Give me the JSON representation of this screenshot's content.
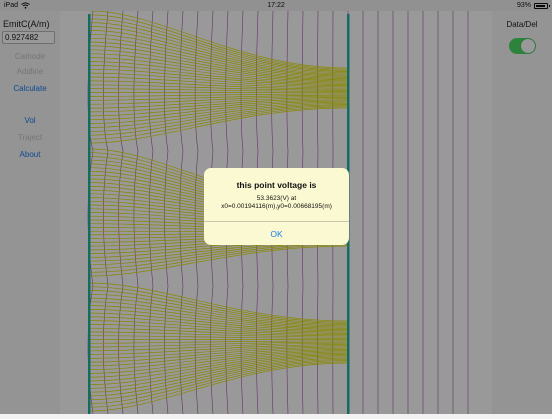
{
  "status_bar": {
    "device": "iPad",
    "time": "17:22",
    "battery": "93%",
    "battery_level": 0.93
  },
  "left_panel": {
    "emit_label": "EmitC(A/m)",
    "emit_value": "0.927482",
    "buttons": [
      {
        "label": "Cathode",
        "enabled": false
      },
      {
        "label": "Addline",
        "enabled": false
      },
      {
        "label": "Calculate",
        "enabled": true
      },
      {
        "label": "Vol",
        "enabled": true
      },
      {
        "label": "Traject",
        "enabled": false
      },
      {
        "label": "About",
        "enabled": true
      }
    ]
  },
  "right_panel": {
    "toggle_label": "Data/Del",
    "toggle_on": true
  },
  "alert": {
    "title": "this point voltage is",
    "line1": "53.3623(V) at",
    "line2": "x0=0.00194116(m),y0=0.00668195(m)",
    "ok_label": "OK"
  },
  "colors": {
    "beam": "#e3e300",
    "electrode": "#1fb5a8",
    "equipotential": "#a058a8",
    "accent": "#1a7cf0",
    "toggle_on": "#4cd964"
  }
}
